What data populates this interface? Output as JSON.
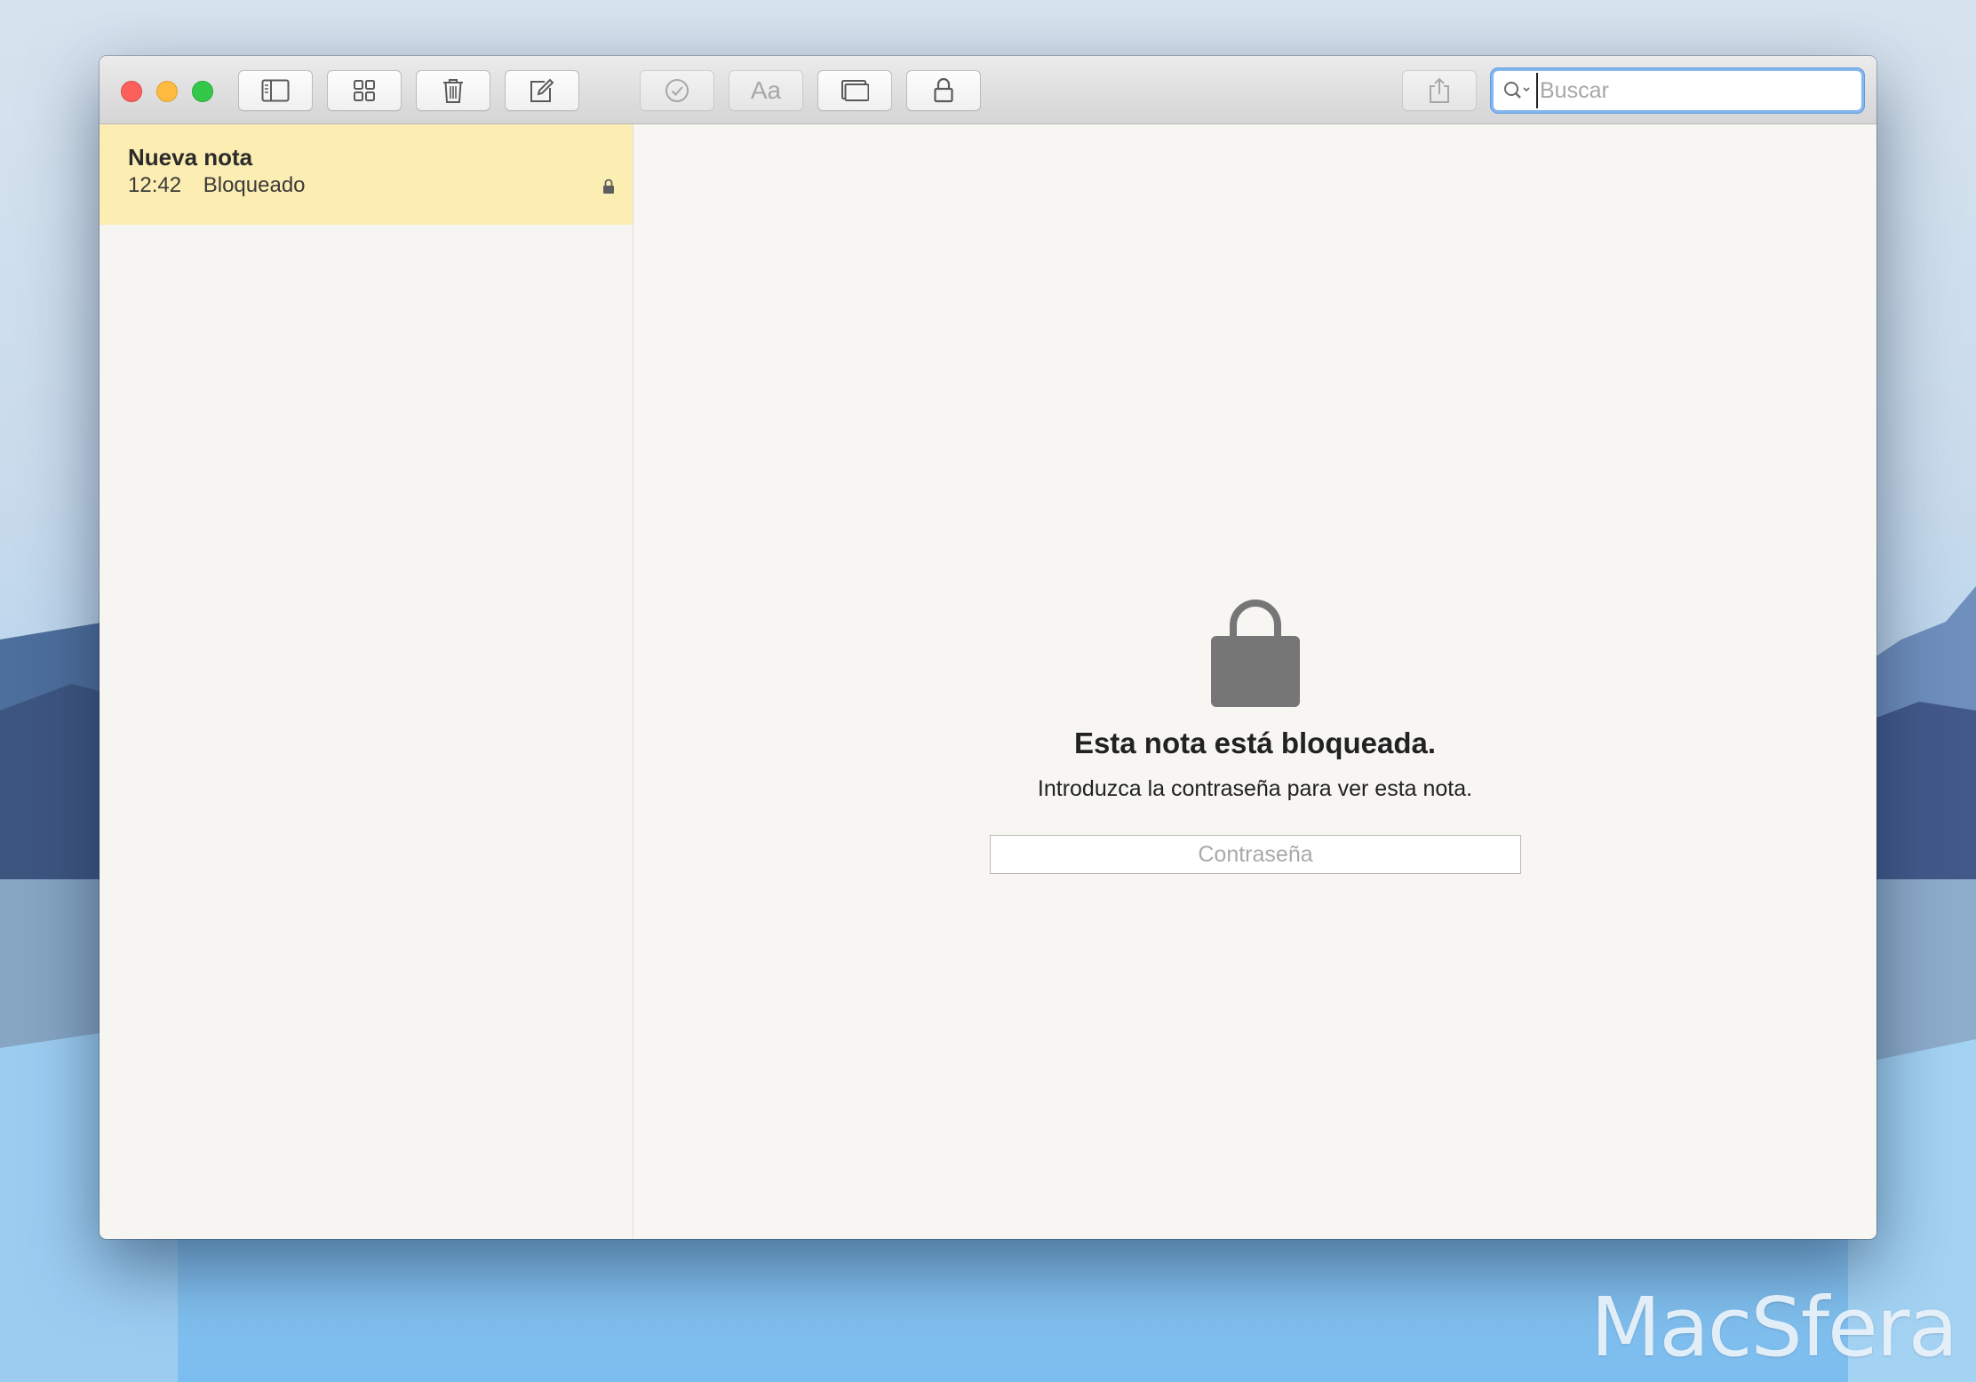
{
  "colors": {
    "note_selected_bg": "#fcedb2",
    "close": "#fc605b",
    "minimize": "#fdbc40",
    "maximize": "#34c84a",
    "search_focus": "#86b6ee",
    "lock_icon": "#767676"
  },
  "toolbar": {
    "buttons": [
      {
        "name": "toggle-sidebar-button",
        "icon": "sidebar-icon"
      },
      {
        "name": "attachments-button",
        "icon": "grid-icon"
      },
      {
        "name": "delete-button",
        "icon": "trash-icon"
      },
      {
        "name": "new-note-button",
        "icon": "compose-icon"
      },
      {
        "name": "checklist-button",
        "icon": "checkmark-circle-icon"
      },
      {
        "name": "format-button",
        "icon": "aa-icon",
        "label": "Aa"
      },
      {
        "name": "add-table-button",
        "icon": "table-icon"
      },
      {
        "name": "lock-button",
        "icon": "lock-icon"
      },
      {
        "name": "share-button",
        "icon": "share-icon"
      }
    ],
    "search": {
      "placeholder": "Buscar",
      "value": ""
    }
  },
  "sidebar": {
    "notes": [
      {
        "title": "Nueva nota",
        "time": "12:42",
        "status": "Bloqueado",
        "locked": true,
        "selected": true
      }
    ]
  },
  "editor": {
    "locked_title": "Esta nota está bloqueada.",
    "locked_subtitle": "Introduzca la contraseña para ver esta nota.",
    "password_placeholder": "Contraseña"
  },
  "watermark": "MacSfera"
}
